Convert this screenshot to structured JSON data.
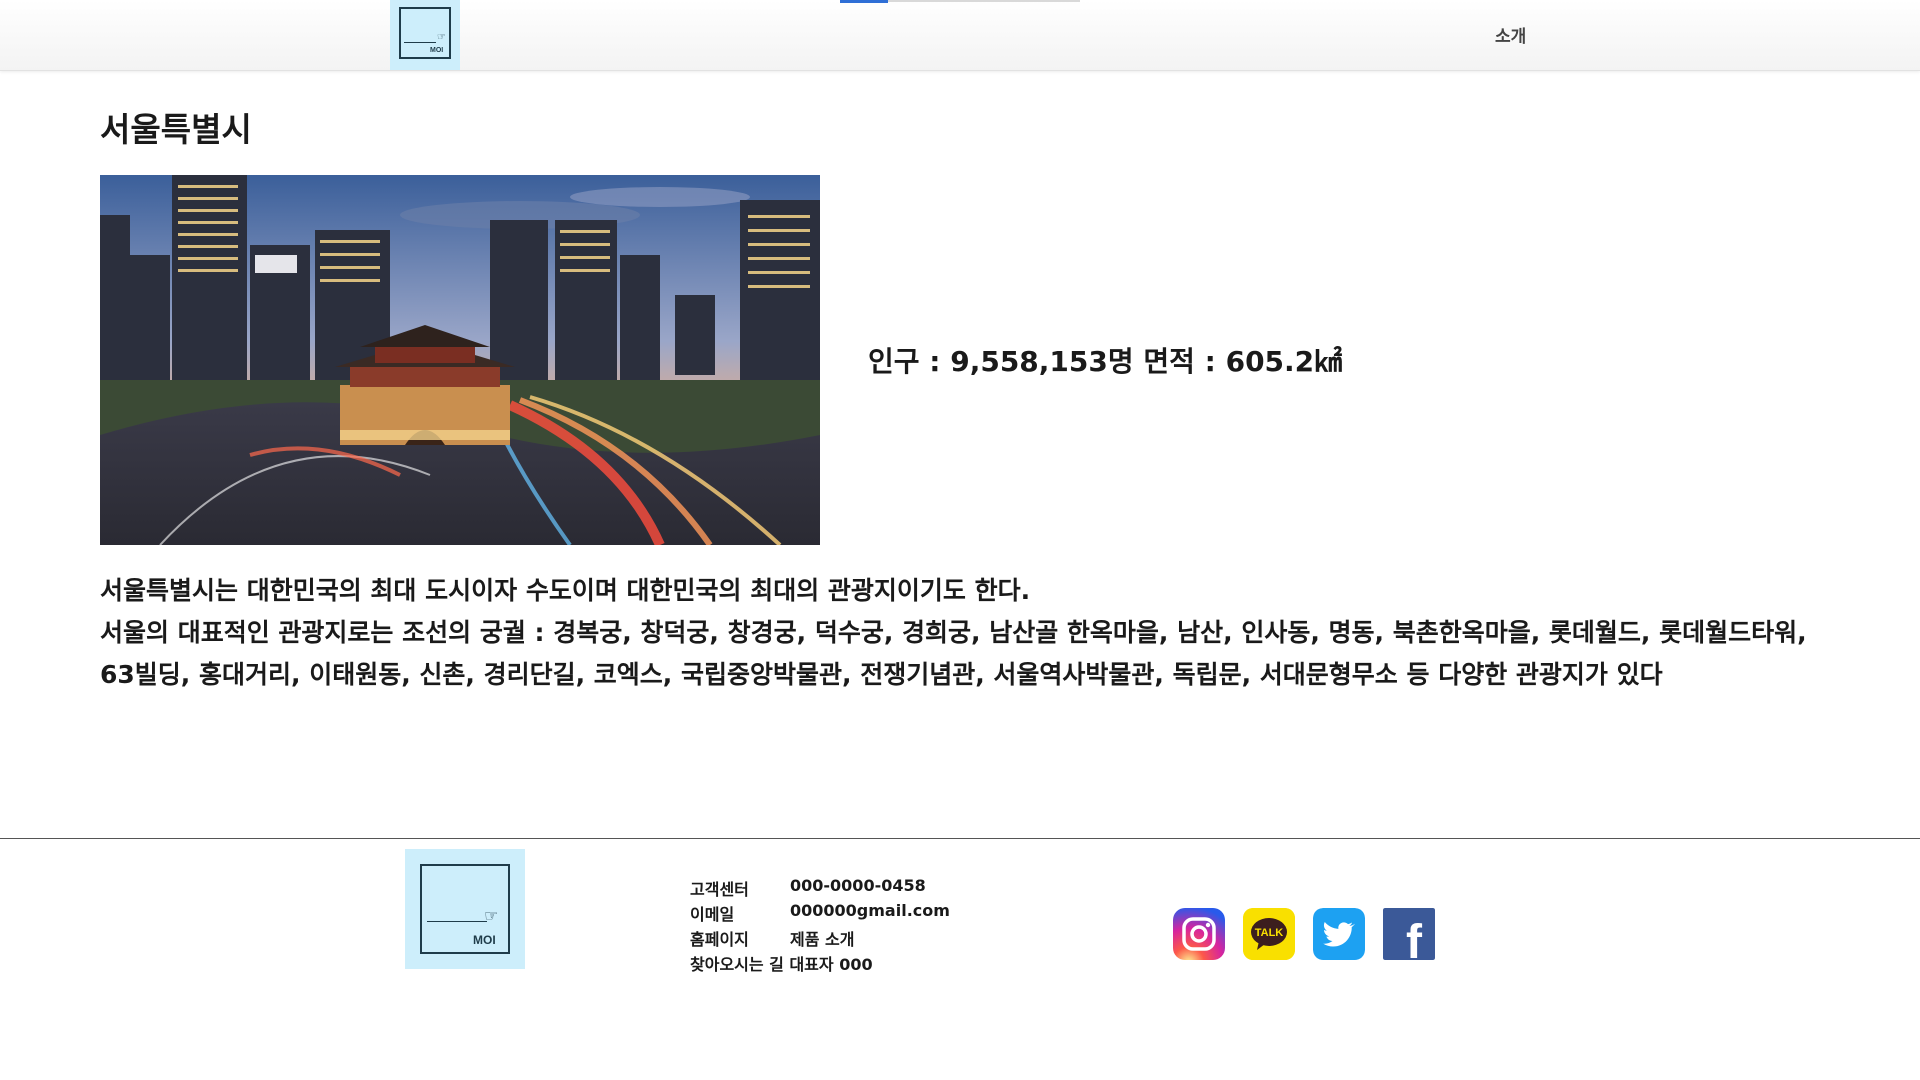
{
  "header": {
    "logo_text": "MOI",
    "nav": {
      "about_label": "소개"
    }
  },
  "main": {
    "title": "서울특별시",
    "stats": "인구 : 9,558,153명 면적 : 605.2㎢",
    "description": [
      "서울특별시는 대한민국의 최대 도시이자 수도이며 대한민국의 최대의 관광지이기도 한다.",
      "서울의 대표적인 관광지로는 조선의 궁궐 : 경복궁, 창덕궁, 창경궁, 덕수궁, 경희궁, 남산골 한옥마을, 남산, 인사동, 명동, 북촌한옥마을, 롯데월드, 롯데월드타워, 63빌딩, 홍대거리, 이태원동, 신촌, 경리단길, 코엑스, 국립중앙박물관, 전쟁기념관, 서울역사박물관, 독립문, 서대문형무소 등 다양한 관광지가 있다"
    ]
  },
  "footer": {
    "logo_text": "MOI",
    "contact": [
      {
        "label": "고객센터",
        "value": "000-0000-0458"
      },
      {
        "label": "이메일",
        "value": "000000gmail.com"
      },
      {
        "label": "홈페이지",
        "value": "제품 소개"
      },
      {
        "label": "찾아오시는 길 대표자 000",
        "value": ""
      }
    ],
    "social": [
      {
        "name": "instagram-icon",
        "glyph": "",
        "color": "#d6249f"
      },
      {
        "name": "kakaotalk-icon",
        "glyph": "TALK",
        "color": "#f9e000"
      },
      {
        "name": "twitter-icon",
        "glyph": "",
        "color": "#1da1f2"
      },
      {
        "name": "facebook-icon",
        "glyph": "f",
        "color": "#3b5998"
      }
    ]
  },
  "colors": {
    "logo_background": "#cdeefb",
    "logo_ink": "#1f3c4a",
    "header_accent": "#2f6fd6"
  }
}
